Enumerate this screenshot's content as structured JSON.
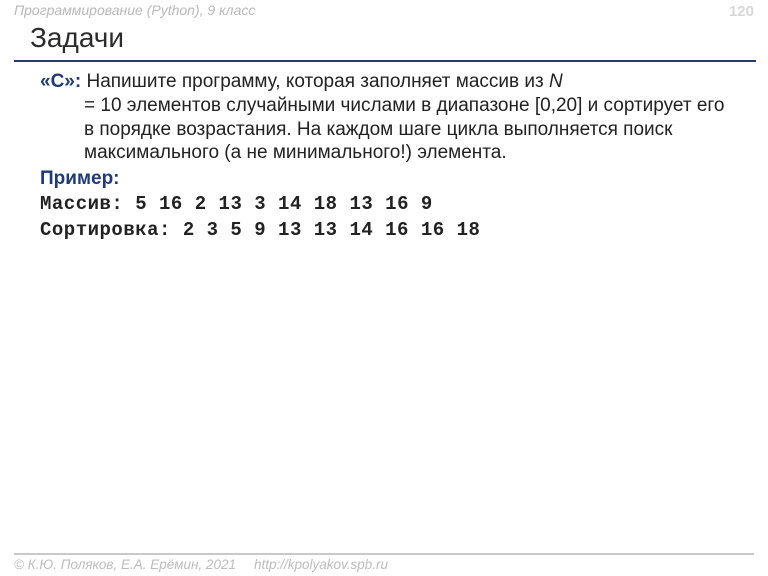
{
  "header": {
    "course": "Программирование (Python), 9 класс",
    "page": "120"
  },
  "title": "Задачи",
  "task": {
    "label": "«С»:",
    "body_line1": "Напишите программу, которая заполняет массив из ",
    "n_var": "N",
    "body_line2": "= 10 элементов случайными числами в диапазоне [0,20] и сортирует его в порядке возрастания. На каждом шаге цикла выполняется поиск максимального (а не минимального!) элемента."
  },
  "example": {
    "label": "Пример:",
    "arr_label": "Массив:",
    "arr_values": " 5 16 2 13 3 14 18 13 16 9",
    "sort_label": "Сортировка:",
    "sort_values": " 2 3 5 9 13 13 14 16 16 18"
  },
  "footer": {
    "copyright": "© К.Ю. Поляков, Е.А. Ерёмин, 2021",
    "url": "http://kpolyakov.spb.ru"
  }
}
